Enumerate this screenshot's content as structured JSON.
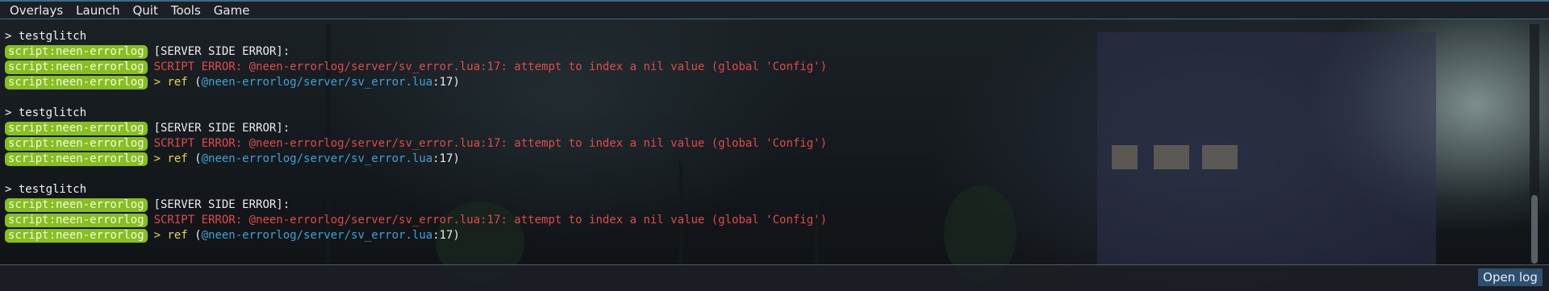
{
  "menubar": {
    "items": [
      "Overlays",
      "Launch",
      "Quit",
      "Tools",
      "Game"
    ]
  },
  "console": {
    "blocks": [
      {
        "command": "> testglitch",
        "tag": "script:neen-errorlog",
        "header": "[SERVER SIDE ERROR]:",
        "error": "SCRIPT ERROR: @neen-errorlog/server/sv_error.lua:17: attempt to index a nil value (global 'Config')",
        "ref_prefix": "> ref",
        "ref_open": " (",
        "ref_path": "@neen-errorlog/server/sv_error.lua",
        "ref_suffix": ":17)"
      },
      {
        "command": "> testglitch",
        "tag": "script:neen-errorlog",
        "header": "[SERVER SIDE ERROR]:",
        "error": "SCRIPT ERROR: @neen-errorlog/server/sv_error.lua:17: attempt to index a nil value (global 'Config')",
        "ref_prefix": "> ref",
        "ref_open": " (",
        "ref_path": "@neen-errorlog/server/sv_error.lua",
        "ref_suffix": ":17)"
      },
      {
        "command": "> testglitch",
        "tag": "script:neen-errorlog",
        "header": "[SERVER SIDE ERROR]:",
        "error": "SCRIPT ERROR: @neen-errorlog/server/sv_error.lua:17: attempt to index a nil value (global 'Config')",
        "ref_prefix": "> ref",
        "ref_open": " (",
        "ref_path": "@neen-errorlog/server/sv_error.lua",
        "ref_suffix": ":17)"
      }
    ]
  },
  "footer": {
    "open_log_label": "Open log"
  },
  "colors": {
    "tag_bg": "#86bf1f",
    "error": "#e24a4a",
    "ref": "#e8d44a",
    "path": "#3da3d6",
    "accent": "#3d6a8a"
  }
}
